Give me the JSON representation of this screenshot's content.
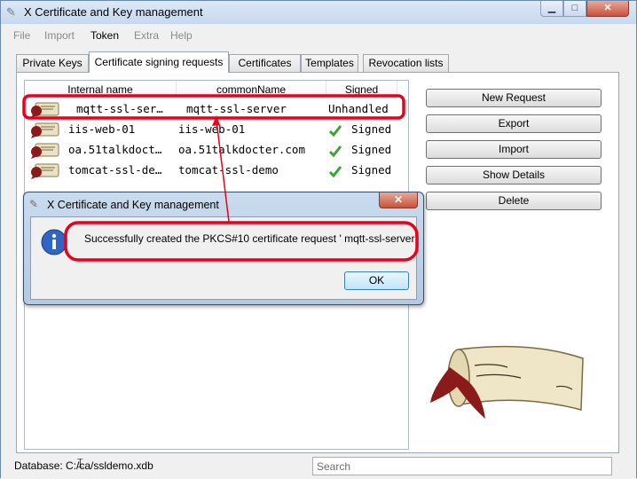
{
  "window": {
    "title": "X Certificate and Key management"
  },
  "menu": {
    "items": [
      "File",
      "Import",
      "Token",
      "Extra",
      "Help"
    ]
  },
  "tabs": [
    "Private Keys",
    "Certificate signing requests",
    "Certificates",
    "Templates",
    "Revocation lists"
  ],
  "list": {
    "columns": [
      "Internal name",
      "commonName",
      "Signed"
    ],
    "rows": [
      {
        "name": "mqtt-ssl-ser…",
        "cn": "mqtt-ssl-server",
        "signed": "Unhandled"
      },
      {
        "name": "iis-web-01",
        "cn": "iis-web-01",
        "signed": "Signed"
      },
      {
        "name": "oa.51talkdoct…",
        "cn": "oa.51talkdocter.com",
        "signed": "Signed"
      },
      {
        "name": "tomcat-ssl-de…",
        "cn": "tomcat-ssl-demo",
        "signed": "Signed"
      }
    ]
  },
  "buttons": {
    "new_request": "New Request",
    "export": "Export",
    "import": "Import",
    "show_details": "Show Details",
    "delete": "Delete"
  },
  "status": {
    "database": "Database: C:/ca/ssldemo.xdb",
    "search_placeholder": "Search"
  },
  "dialog": {
    "title": "X Certificate and Key management",
    "message": "Successfully created the PKCS#10 certificate request ' mqtt-ssl-server'",
    "ok": "OK"
  },
  "colors": {
    "annotation": "#e8001c",
    "check": "#3aa52f"
  }
}
